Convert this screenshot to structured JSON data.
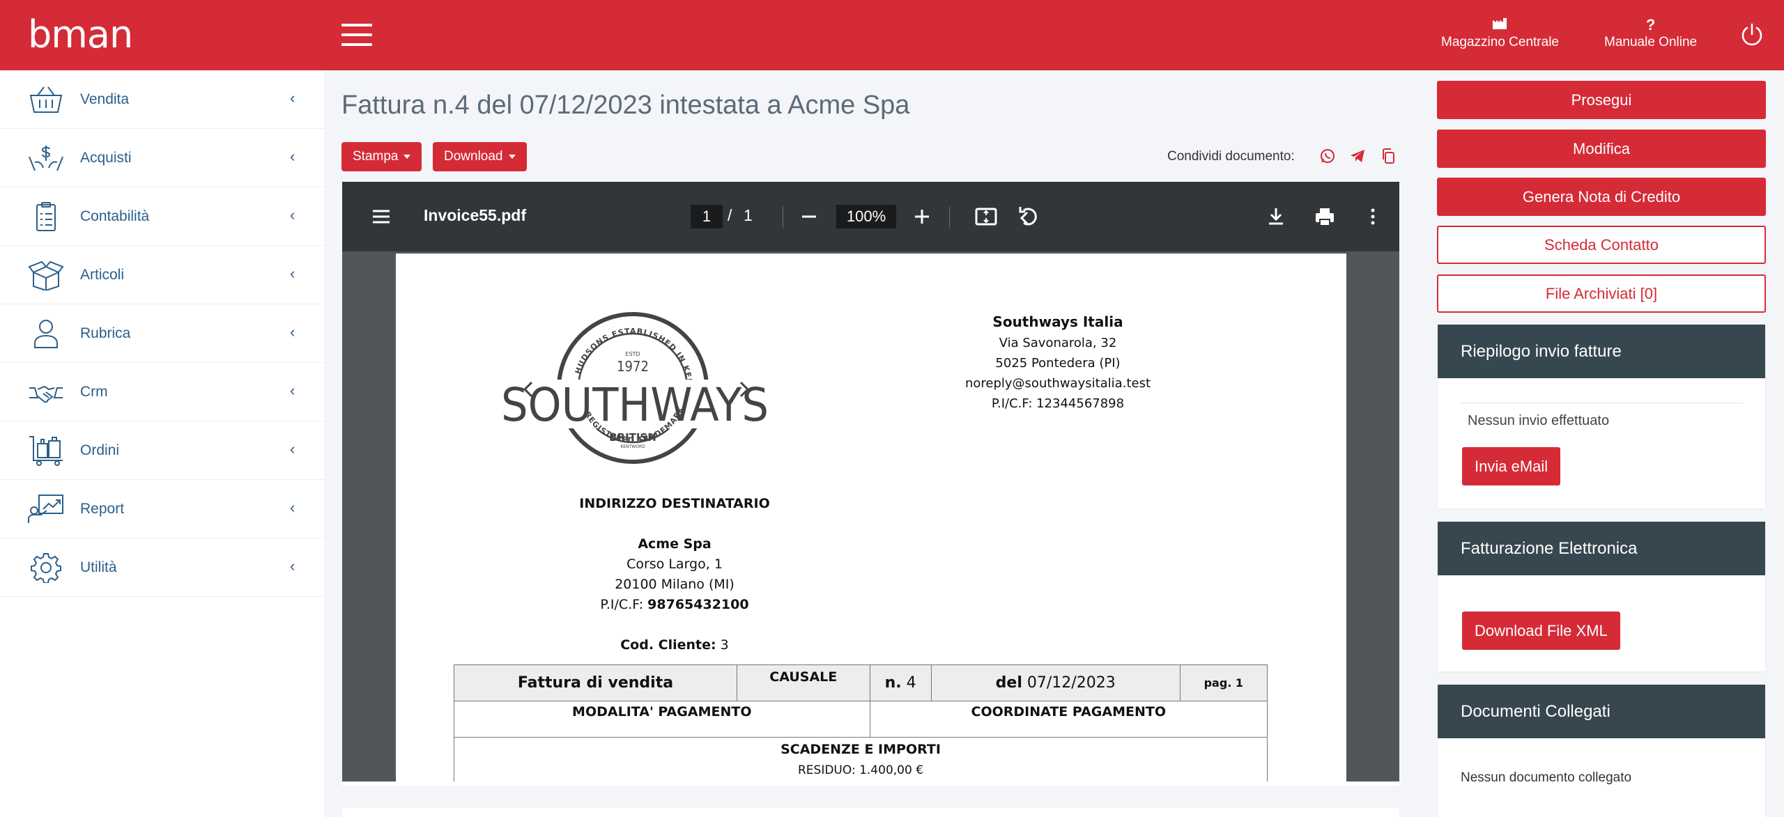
{
  "brand": {
    "logo": "bman",
    "primary": "#d52b37",
    "dark": "#37474f",
    "link": "#2b5f8a"
  },
  "topbar": {
    "menu_icon": "hamburger-icon",
    "links": [
      {
        "label": "Magazzino Centrale",
        "icon": "warehouse-icon"
      },
      {
        "label": "Manuale Online",
        "icon": "question-icon"
      }
    ],
    "power_icon": "power-icon"
  },
  "sidebar": {
    "items": [
      {
        "label": "Vendita",
        "icon": "basket-icon"
      },
      {
        "label": "Acquisti",
        "icon": "money-hands-icon"
      },
      {
        "label": "Contabilità",
        "icon": "clipboard-icon"
      },
      {
        "label": "Articoli",
        "icon": "box-icon"
      },
      {
        "label": "Rubrica",
        "icon": "user-icon"
      },
      {
        "label": "Crm",
        "icon": "handshake-icon"
      },
      {
        "label": "Ordini",
        "icon": "luggage-cart-icon"
      },
      {
        "label": "Report",
        "icon": "chart-user-icon"
      },
      {
        "label": "Utilità",
        "icon": "gear-icon"
      }
    ],
    "chevron": "‹"
  },
  "main": {
    "title": "Fattura n.4 del 07/12/2023 intestata a Acme Spa",
    "print_label": "Stampa",
    "download_label": "Download",
    "share_label": "Condividi documento:"
  },
  "viewer": {
    "filename": "Invoice55.pdf",
    "page_current": "1",
    "page_sep": "/",
    "page_total": "1",
    "zoom": "100%"
  },
  "invoice": {
    "logo": {
      "top": "HUDSONS ESTABLISHED IN KENTWORD",
      "estd": "ESTD",
      "year": "1972",
      "name": "SOUTHWAYS",
      "sub": "BRITISH",
      "sub2": "KENTWORD",
      "bottom": "REGISTERED TRADEMARK COMPANY"
    },
    "sender": {
      "name": "Southways Italia",
      "address": "Via Savonarola, 32",
      "city": "5025 Pontedera (PI)",
      "email": "noreply@southwaysitalia.test",
      "vat": "P.I/C.F: 12344567898"
    },
    "recipient": {
      "heading": "INDIRIZZO DESTINATARIO",
      "name": "Acme Spa",
      "address": "Corso Largo, 1",
      "city": "20100 Milano (MI)",
      "vat_label": "P.I/C.F:",
      "vat": "98765432100",
      "customer_code_label": "Cod. Cliente:",
      "customer_code": "3"
    },
    "table": {
      "doc_type": "Fattura di vendita",
      "causale": "CAUSALE",
      "num_label": "n.",
      "num": "4",
      "date_label": "del",
      "date": "07/12/2023",
      "page": "pag. 1",
      "payment_mode": "MODALITA' PAGAMENTO",
      "payment_coords": "COORDINATE PAGAMENTO",
      "due": "SCADENZE E IMPORTI",
      "residual": "RESIDUO: 1.400,00 €"
    }
  },
  "actions": {
    "proceed": "Prosegui",
    "edit": "Modifica",
    "credit_note": "Genera Nota di Credito",
    "contact_card": "Scheda Contatto",
    "archived_files": "File Archiviati [0]"
  },
  "panels": {
    "summary": {
      "title": "Riepilogo invio fatture",
      "empty": "Nessun invio effettuato",
      "button": "Invia eMail"
    },
    "einvoice": {
      "title": "Fatturazione Elettronica",
      "button": "Download File XML"
    },
    "linked": {
      "title": "Documenti Collegati",
      "empty": "Nessun documento collegato"
    }
  }
}
